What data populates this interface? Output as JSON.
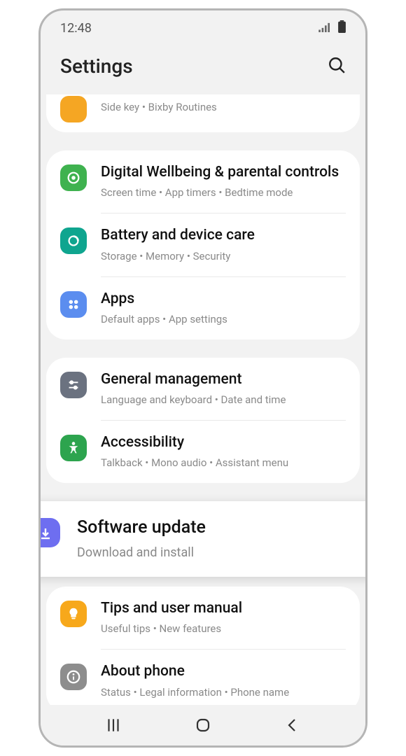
{
  "status": {
    "time": "12:48"
  },
  "header": {
    "title": "Settings"
  },
  "partialRow": {
    "sub": "Side key  •  Bixby Routines"
  },
  "group1": [
    {
      "title": "Digital Wellbeing & parental controls",
      "sub": "Screen time  •  App timers  •  Bedtime mode"
    },
    {
      "title": "Battery and device care",
      "sub": "Storage  •  Memory  •  Security"
    },
    {
      "title": "Apps",
      "sub": "Default apps  •  App settings"
    }
  ],
  "group2": [
    {
      "title": "General management",
      "sub": "Language and keyboard  •  Date and time"
    },
    {
      "title": "Accessibility",
      "sub": "Talkback  •  Mono audio  •  Assistant menu"
    }
  ],
  "elevated": {
    "title": "Software update",
    "sub": "Download and install"
  },
  "group3": [
    {
      "title": "Tips and user manual",
      "sub": "Useful tips  •  New features"
    },
    {
      "title": "About phone",
      "sub": "Status  •  Legal information  •  Phone name"
    }
  ]
}
